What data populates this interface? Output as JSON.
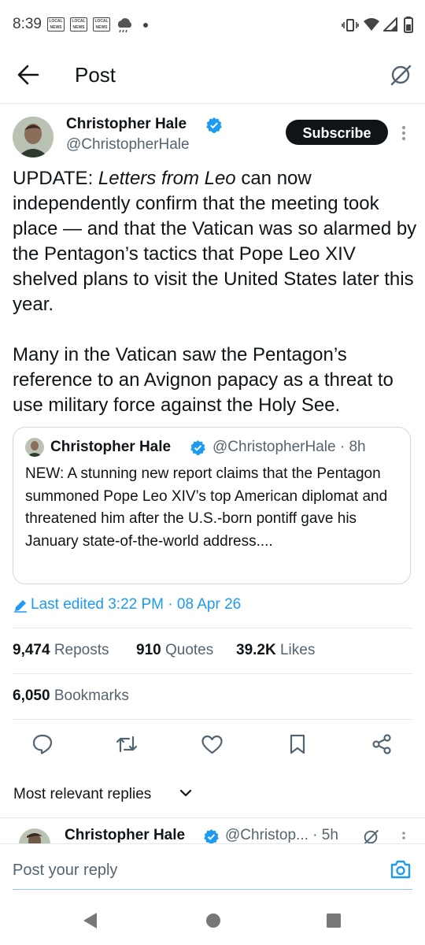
{
  "status_bar": {
    "time": "8:39",
    "notification_badges": [
      "LOCAL NEWS",
      "LOCAL NEWS",
      "LOCAL NEWS"
    ]
  },
  "header": {
    "title": "Post"
  },
  "post": {
    "author_name": "Christopher Hale",
    "author_handle": "@ChristopherHale",
    "subscribe_label": "Subscribe",
    "body_update_prefix": "UPDATE: ",
    "body_update_italic": "Letters from Leo",
    "body_update_rest": " can now independently confirm that the meeting took place — and that the Vatican was so alarmed by the Pentagon’s tactics that Pope Leo XIV shelved plans to visit the United States later this year.",
    "body_paragraph_2": "Many in the Vatican saw the Pentagon’s reference to an Avignon papacy as a threat to use military force against the Holy See.",
    "quote": {
      "author_name": "Christopher Hale",
      "meta": "@ChristopherHale · 8h",
      "text": "NEW: A stunning new report claims that the Pentagon summoned Pope Leo XIV’s top American diplomat and threatened him after the U.S.-born pontiff gave his January state-of-the-world address...."
    },
    "edited_label": "Last edited 3:22 PM · 08 Apr 26",
    "stats": {
      "reposts_count": "9,474",
      "reposts_label": "Reposts",
      "quotes_count": "910",
      "quotes_label": "Quotes",
      "likes_count": "39.2K",
      "likes_label": "Likes",
      "bookmarks_count": "6,050",
      "bookmarks_label": "Bookmarks"
    }
  },
  "replies": {
    "sort_label": "Most relevant replies",
    "first_reply": {
      "author_name": "Christopher Hale",
      "meta": "@Christop... · 5h"
    }
  },
  "composer": {
    "placeholder": "Post your reply"
  },
  "colors": {
    "accent": "#1d9bf0",
    "text": "#0f1419",
    "secondary": "#536471",
    "border": "#cfd9de"
  }
}
